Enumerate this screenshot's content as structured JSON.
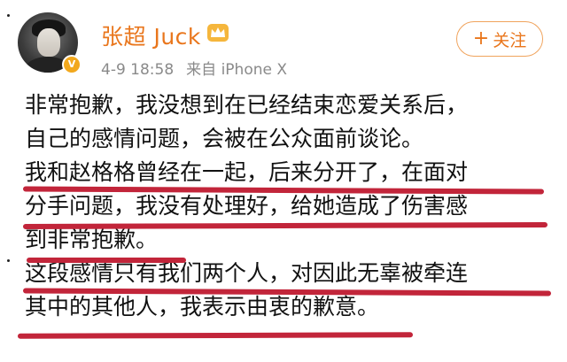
{
  "header": {
    "username": "张超 Juck",
    "timestamp": "4-9 18:58",
    "source": "来自 iPhone X",
    "follow_label": "关注",
    "follow_prefix": "+",
    "badge_icon": "verified-v-icon",
    "crown_icon": "crown-icon"
  },
  "post": {
    "lines": [
      "非常抱歉，我没想到在已经结束恋爱关系后，",
      "自己的感情问题，会被在公众面前谈论。",
      "我和赵格格曾经在一起，后来分开了，在面对",
      "分手问题，我没有处理好，给她造成了伤害感",
      "到非常抱歉。",
      "这段感情只有我们两个人，对因此无辜被牵连",
      "其中的其他人，我表示由衷的歉意。"
    ]
  },
  "colors": {
    "username": "#e9761c",
    "underline": "#c2253a",
    "meta": "#8a8a8a"
  }
}
